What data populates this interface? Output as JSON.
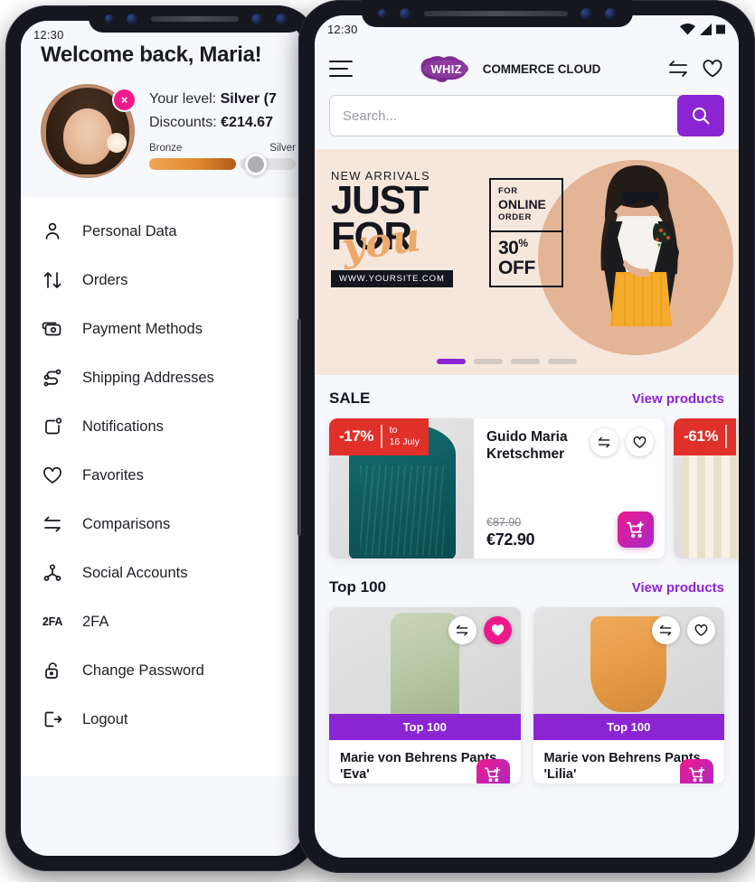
{
  "status_bar": {
    "time": "12:30",
    "icons": [
      "wifi-icon",
      "signal-icon",
      "battery-icon"
    ]
  },
  "account": {
    "welcome_title": "Welcome back, Maria!",
    "avatar_badge": "×",
    "level_prefix": "Your level: ",
    "level_value": "Silver (7",
    "discount_prefix": "Discounts: ",
    "discount_value": "€214.67",
    "tier_from": "Bronze",
    "tier_to": "Silver",
    "menu": [
      {
        "label": "Personal Data",
        "icon": "user-icon"
      },
      {
        "label": "Orders",
        "icon": "arrows-up-down-icon"
      },
      {
        "label": "Payment Methods",
        "icon": "card-icon"
      },
      {
        "label": "Shipping Addresses",
        "icon": "route-icon"
      },
      {
        "label": "Notifications",
        "icon": "bell-dot-icon"
      },
      {
        "label": "Favorites",
        "icon": "heart-icon"
      },
      {
        "label": "Comparisons",
        "icon": "compare-icon"
      },
      {
        "label": "Social Accounts",
        "icon": "share-nodes-icon"
      },
      {
        "label": "2FA",
        "icon": "twofa-icon"
      },
      {
        "label": "Change Password",
        "icon": "unlock-icon"
      },
      {
        "label": "Logout",
        "icon": "logout-icon"
      }
    ]
  },
  "shop": {
    "brand_mark": "WHIZ",
    "brand_name": "COMMERCE CLOUD",
    "header_icons": [
      "menu-icon",
      "compare-icon",
      "heart-icon"
    ],
    "search": {
      "placeholder": "Search...",
      "value": ""
    },
    "banner": {
      "eyebrow": "NEW ARRIVALS",
      "line1": "JUST",
      "line2": "FOR",
      "script": "you",
      "url": "WWW.YOURSITE.COM",
      "box_for": "FOR",
      "box_online": "ONLINE",
      "box_order": "ORDER",
      "box_pct": "30",
      "box_pct_sym": "%",
      "box_off": "OFF",
      "slides": 4,
      "active_slide": 1
    },
    "sections": [
      {
        "title": "SALE",
        "link": "View products",
        "products": [
          {
            "name": "Guido Maria Kretschmer",
            "discount": "-17%",
            "to_label": "to",
            "to_date": "16 July",
            "price_old": "€87.90",
            "price_new": "€72.90",
            "favorited": false
          },
          {
            "name": "",
            "discount": "-61%",
            "favorited": false
          }
        ]
      },
      {
        "title": "Top 100",
        "link": "View products",
        "products": [
          {
            "name": "Marie von Behrens Pants 'Eva'",
            "badge": "Top 100",
            "favorited": true
          },
          {
            "name": "Marie von Behrens Pants 'Lilia'",
            "badge": "Top 100",
            "favorited": false
          }
        ]
      }
    ]
  },
  "colors": {
    "accent_purple": "#8b25d4",
    "accent_pink": "#ec1b8c",
    "sale_red": "#e0302a",
    "frame_dark": "#15161e",
    "banner_bg": "#f6e7dc"
  }
}
